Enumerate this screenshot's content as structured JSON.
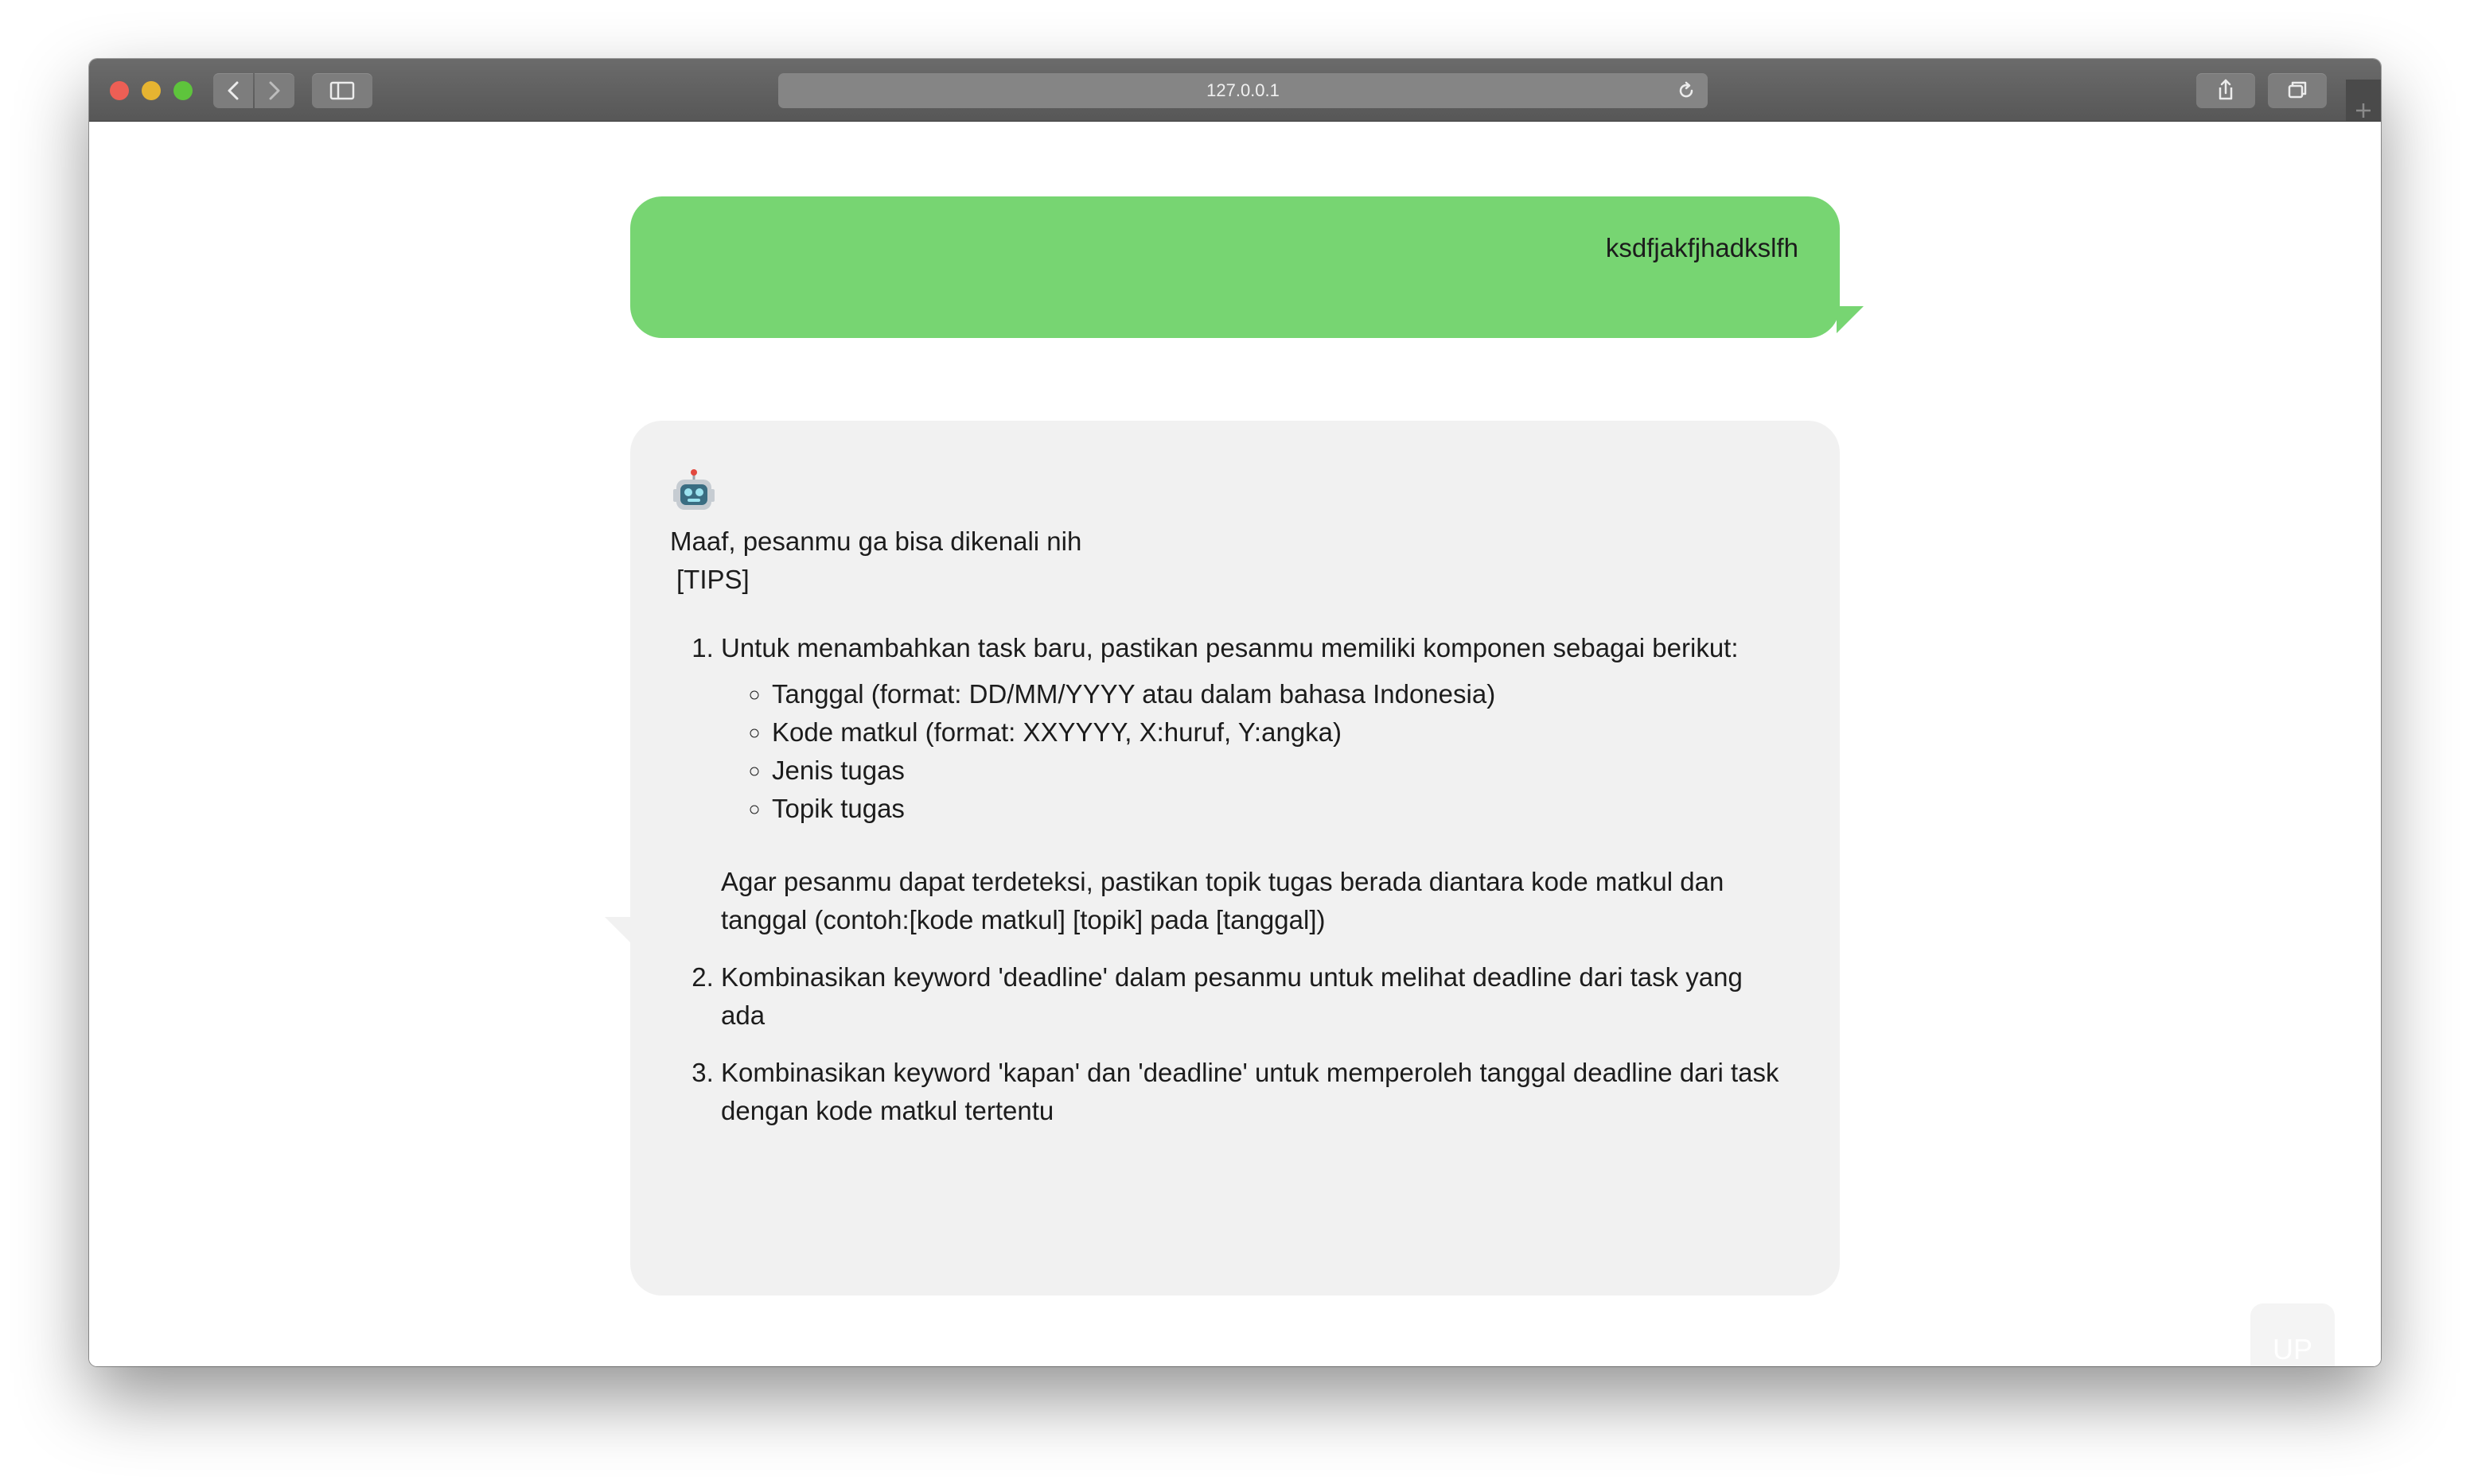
{
  "browser": {
    "url": "127.0.0.1"
  },
  "chat": {
    "user_message": "ksdfjakfjhadkslfh",
    "bot_avatar": "robot-icon",
    "bot_reply": {
      "intro": "Maaf, pesanmu ga bisa dikenali nih",
      "tips_label": "[TIPS]",
      "tips": [
        {
          "text": "Untuk menambahkan task baru, pastikan pesanmu memiliki komponen sebagai berikut:",
          "components": [
            "Tanggal (format: DD/MM/YYYY atau dalam bahasa Indonesia)",
            "Kode matkul (format: XXYYYY, X:huruf, Y:angka)",
            "Jenis tugas",
            "Topik tugas"
          ],
          "note": "Agar pesanmu dapat terdeteksi, pastikan topik tugas berada diantara kode matkul dan tanggal (contoh:[kode matkul] [topik] pada [tanggal])"
        },
        {
          "text": "Kombinasikan keyword 'deadline' dalam pesanmu untuk melihat deadline dari task yang ada"
        },
        {
          "text": "Kombinasikan keyword 'kapan' dan 'deadline' untuk memperoleh tanggal deadline dari task dengan kode matkul tertentu"
        }
      ]
    }
  },
  "scroll_up_button": {
    "label": "UP"
  },
  "colors": {
    "user_bubble": "#77d572",
    "bot_bubble": "#f1f1f1"
  }
}
